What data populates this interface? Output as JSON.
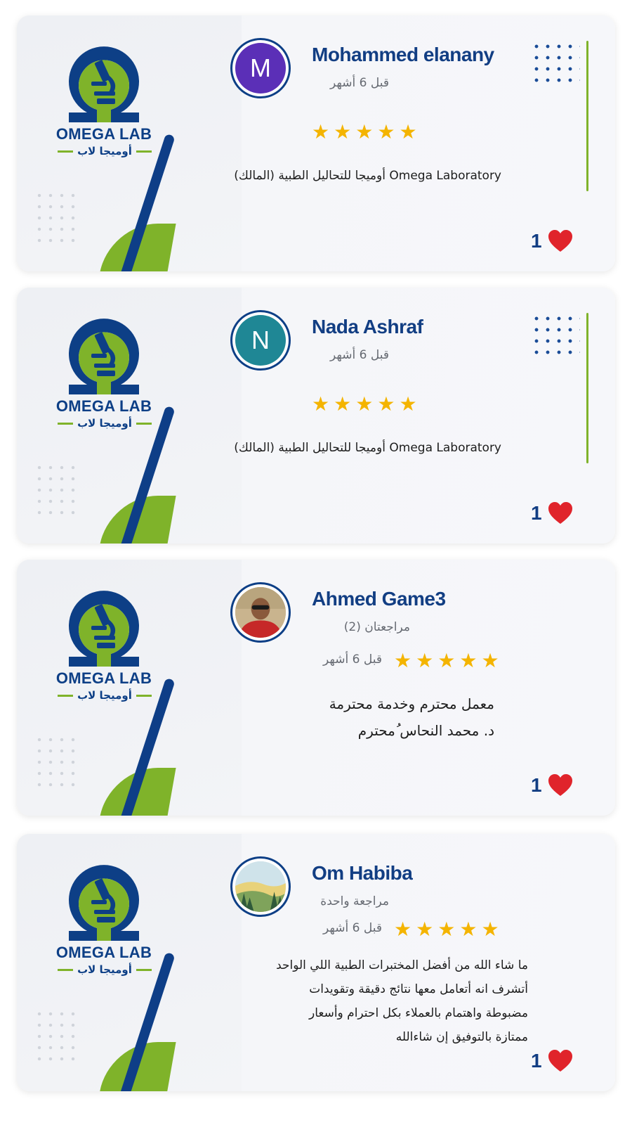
{
  "brand": {
    "logo_text_en": "OMEGA LAB",
    "logo_text_ar": "أوميجا لاب",
    "colors": {
      "navy": "#0d3f86",
      "green": "#7fb32a",
      "star": "#f4b400",
      "heart": "#e0242b"
    }
  },
  "reviews": [
    {
      "name": "Mohammed elanany",
      "avatar_letter": "M",
      "avatar_color": "#5b2fb7",
      "time": "قبل 6 أشهر",
      "rating": 5,
      "text": "Omega Laboratory أوميجا للتحاليل الطبية (المالك)",
      "likes": "1"
    },
    {
      "name": "Nada Ashraf",
      "avatar_letter": "N",
      "avatar_color": "#1f8795",
      "time": "قبل 6 أشهر",
      "rating": 5,
      "text": "Omega Laboratory أوميجا للتحاليل الطبية (المالك)",
      "likes": "1"
    },
    {
      "name": "Ahmed Game3",
      "avatar_icon": "person-photo-icon",
      "reviews_count": "مراجعتان (2)",
      "time": "قبل 6 أشهر",
      "rating": 5,
      "text_lines": [
        "معمل محترم وخدمة محترمة",
        "د. محمد النحاس ُمحترم"
      ],
      "likes": "1"
    },
    {
      "name": "Om Habiba",
      "avatar_icon": "landscape-photo-icon",
      "reviews_count": "مراجعة واحدة",
      "time": "قبل 6 أشهر",
      "rating": 5,
      "text_lines": [
        "ما شاء الله من أفضل المختبرات الطبية اللي الواحد",
        "أتشرف انه أتعامل معها نتائج دقيقة وتقويدات",
        "مضبوطة واهتمام بالعملاء بكل احترام وأسعار",
        "ممتازة بالتوفيق إن شاءالله"
      ],
      "likes": "1"
    }
  ]
}
